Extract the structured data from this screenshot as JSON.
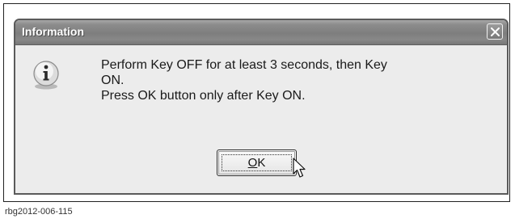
{
  "dialog": {
    "title": "Information",
    "close_icon": "close-icon",
    "icon": "information-icon",
    "message_lines": [
      "Perform Key OFF for at least 3 seconds, then Key",
      "ON.",
      "Press OK button only after Key ON."
    ],
    "ok_button": {
      "mnemonic": "O",
      "rest": "K"
    },
    "cursor_icon": "pointer-cursor-icon"
  },
  "caption": "rbg2012-006-115"
}
